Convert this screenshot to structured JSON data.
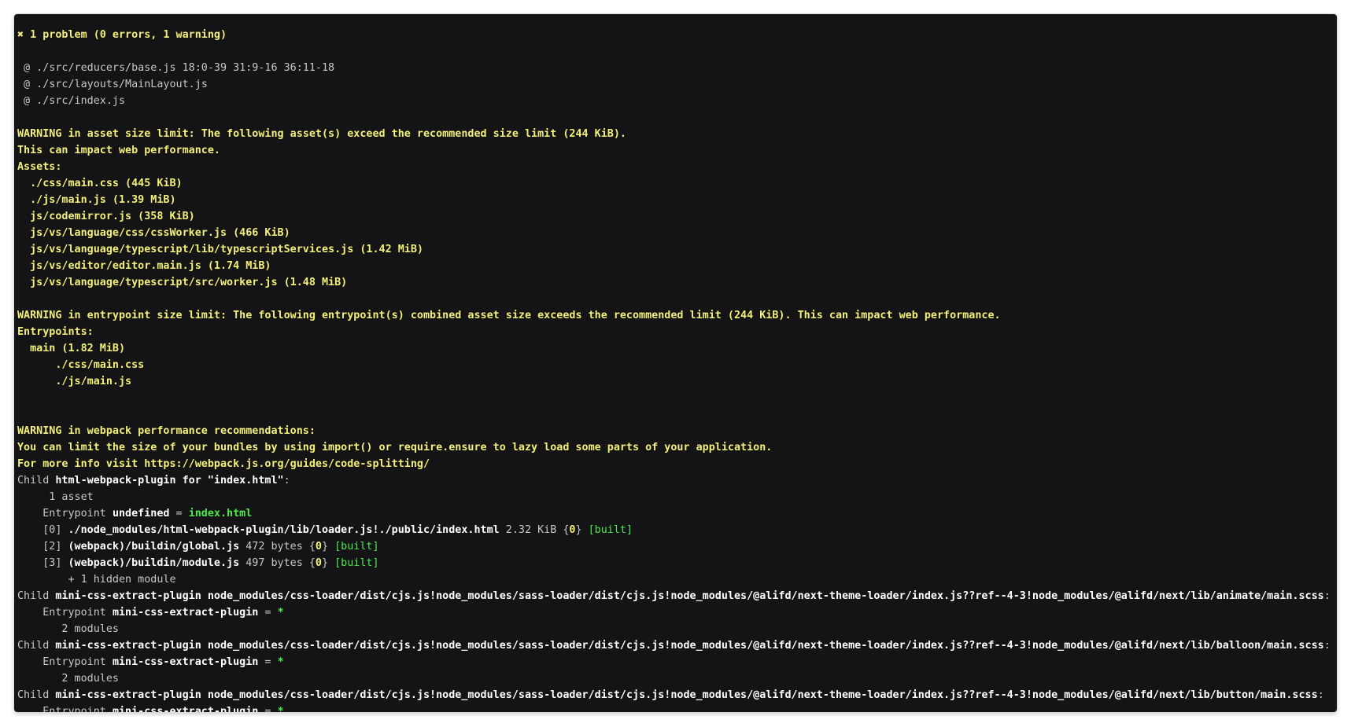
{
  "terminal": {
    "lines": [
      [
        {
          "t": "✖",
          "c": "x",
          "n": "error-x-icon"
        },
        {
          "t": " 1 problem (0 errors, 1 warning)",
          "c": "y"
        }
      ],
      [],
      [
        {
          "t": " @ ./src/reducers/base.js 18:0-39 31:9-16 36:11-18",
          "c": "g"
        }
      ],
      [
        {
          "t": " @ ./src/layouts/MainLayout.js",
          "c": "g"
        }
      ],
      [
        {
          "t": " @ ./src/index.js",
          "c": "g"
        }
      ],
      [],
      [
        {
          "t": "WARNING in asset size limit: The following asset(s) exceed the recommended size limit (244 KiB).",
          "c": "y"
        }
      ],
      [
        {
          "t": "This can impact web performance.",
          "c": "y"
        }
      ],
      [
        {
          "t": "Assets:",
          "c": "y"
        }
      ],
      [
        {
          "t": "  ./css/main.css (445 KiB)",
          "c": "y"
        }
      ],
      [
        {
          "t": "  ./js/main.js (1.39 MiB)",
          "c": "y"
        }
      ],
      [
        {
          "t": "  js/codemirror.js (358 KiB)",
          "c": "y"
        }
      ],
      [
        {
          "t": "  js/vs/language/css/cssWorker.js (466 KiB)",
          "c": "y"
        }
      ],
      [
        {
          "t": "  js/vs/language/typescript/lib/typescriptServices.js (1.42 MiB)",
          "c": "y"
        }
      ],
      [
        {
          "t": "  js/vs/editor/editor.main.js (1.74 MiB)",
          "c": "y"
        }
      ],
      [
        {
          "t": "  js/vs/language/typescript/src/worker.js (1.48 MiB)",
          "c": "y"
        }
      ],
      [],
      [
        {
          "t": "WARNING in entrypoint size limit: The following entrypoint(s) combined asset size exceeds the recommended limit (244 KiB). This can impact web performance.",
          "c": "y"
        }
      ],
      [
        {
          "t": "Entrypoints:",
          "c": "y"
        }
      ],
      [
        {
          "t": "  main (1.82 MiB)",
          "c": "y"
        }
      ],
      [
        {
          "t": "      ./css/main.css",
          "c": "y"
        }
      ],
      [
        {
          "t": "      ./js/main.js",
          "c": "y"
        }
      ],
      [],
      [],
      [
        {
          "t": "WARNING in webpack performance recommendations:",
          "c": "y"
        }
      ],
      [
        {
          "t": "You can limit the size of your bundles by using import() or require.ensure to lazy load some parts of your application.",
          "c": "y"
        }
      ],
      [
        {
          "t": "For more info visit https://webpack.js.org/guides/code-splitting/",
          "c": "y"
        }
      ],
      [
        {
          "t": "Child ",
          "c": "g"
        },
        {
          "t": "html-webpack-plugin for \"index.html\"",
          "c": "w"
        },
        {
          "t": ":",
          "c": "g"
        }
      ],
      [
        {
          "t": "     1 asset",
          "c": "g"
        }
      ],
      [
        {
          "t": "    Entrypoint ",
          "c": "g"
        },
        {
          "t": "undefined",
          "c": "w"
        },
        {
          "t": " = ",
          "c": "g"
        },
        {
          "t": "index.html",
          "c": "grb"
        }
      ],
      [
        {
          "t": "    [0] ",
          "c": "g"
        },
        {
          "t": "./node_modules/html-webpack-plugin/lib/loader.js!./public/index.html",
          "c": "w"
        },
        {
          "t": " 2.32 KiB {",
          "c": "g"
        },
        {
          "t": "0",
          "c": "y"
        },
        {
          "t": "} ",
          "c": "g"
        },
        {
          "t": "[built]",
          "c": "gr"
        }
      ],
      [
        {
          "t": "    [2] ",
          "c": "g"
        },
        {
          "t": "(webpack)/buildin/global.js",
          "c": "w"
        },
        {
          "t": " 472 bytes {",
          "c": "g"
        },
        {
          "t": "0",
          "c": "y"
        },
        {
          "t": "} ",
          "c": "g"
        },
        {
          "t": "[built]",
          "c": "gr"
        }
      ],
      [
        {
          "t": "    [3] ",
          "c": "g"
        },
        {
          "t": "(webpack)/buildin/module.js",
          "c": "w"
        },
        {
          "t": " 497 bytes {",
          "c": "g"
        },
        {
          "t": "0",
          "c": "y"
        },
        {
          "t": "} ",
          "c": "g"
        },
        {
          "t": "[built]",
          "c": "gr"
        }
      ],
      [
        {
          "t": "        + 1 hidden module",
          "c": "g"
        }
      ],
      [
        {
          "t": "Child ",
          "c": "g"
        },
        {
          "t": "mini-css-extract-plugin node_modules/css-loader/dist/cjs.js!node_modules/sass-loader/dist/cjs.js!node_modules/@alifd/next-theme-loader/index.js??ref--4-3!node_modules/@alifd/next/lib/animate/main.scss",
          "c": "w"
        },
        {
          "t": ":",
          "c": "g"
        }
      ],
      [
        {
          "t": "    Entrypoint ",
          "c": "g"
        },
        {
          "t": "mini-css-extract-plugin",
          "c": "w"
        },
        {
          "t": " = ",
          "c": "g"
        },
        {
          "t": "*",
          "c": "grb"
        }
      ],
      [
        {
          "t": "       2 modules",
          "c": "g"
        }
      ],
      [
        {
          "t": "Child ",
          "c": "g"
        },
        {
          "t": "mini-css-extract-plugin node_modules/css-loader/dist/cjs.js!node_modules/sass-loader/dist/cjs.js!node_modules/@alifd/next-theme-loader/index.js??ref--4-3!node_modules/@alifd/next/lib/balloon/main.scss",
          "c": "w"
        },
        {
          "t": ":",
          "c": "g"
        }
      ],
      [
        {
          "t": "    Entrypoint ",
          "c": "g"
        },
        {
          "t": "mini-css-extract-plugin",
          "c": "w"
        },
        {
          "t": " = ",
          "c": "g"
        },
        {
          "t": "*",
          "c": "grb"
        }
      ],
      [
        {
          "t": "       2 modules",
          "c": "g"
        }
      ],
      [
        {
          "t": "Child ",
          "c": "g"
        },
        {
          "t": "mini-css-extract-plugin node_modules/css-loader/dist/cjs.js!node_modules/sass-loader/dist/cjs.js!node_modules/@alifd/next-theme-loader/index.js??ref--4-3!node_modules/@alifd/next/lib/button/main.scss",
          "c": "w"
        },
        {
          "t": ":",
          "c": "g"
        }
      ],
      [
        {
          "t": "    Entrypoint ",
          "c": "g"
        },
        {
          "t": "mini-css-extract-plugin",
          "c": "w"
        },
        {
          "t": " = ",
          "c": "g"
        },
        {
          "t": "*",
          "c": "grb"
        }
      ]
    ]
  }
}
